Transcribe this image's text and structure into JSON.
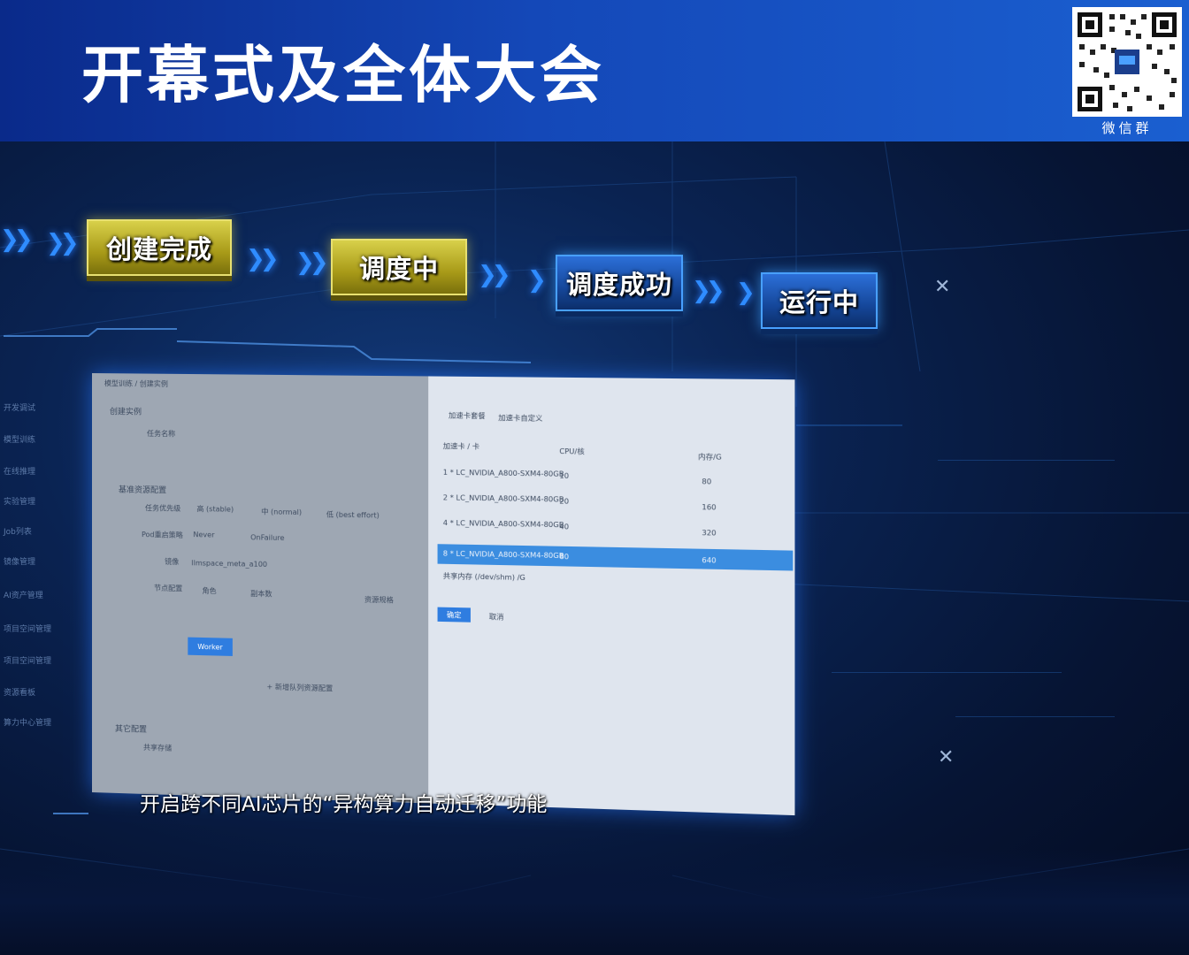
{
  "header": {
    "title": "开幕式及全体大会",
    "qr_caption": "微信群"
  },
  "steps": [
    {
      "label": "创建完成",
      "style": "yellow"
    },
    {
      "label": "调度中",
      "style": "yellow"
    },
    {
      "label": "调度成功",
      "style": "blue"
    },
    {
      "label": "运行中",
      "style": "blue"
    }
  ],
  "screen": {
    "breadcrumb": "模型训练 / 创建实例",
    "section_title": "创建实例",
    "name_label": "任务名称",
    "resource_section": "基准资源配置",
    "priority_label": "任务优先级",
    "priority_options": [
      "高 (stable)",
      "中 (normal)",
      "低 (best effort)"
    ],
    "pod_restart_label": "Pod重启策略",
    "pod_restart_options": [
      "Never",
      "OnFailure"
    ],
    "image_label": "镜像",
    "image_value": "llmspace_meta_a100",
    "node_label": "节点配置",
    "node_columns": [
      "角色",
      "副本数",
      "资源规格"
    ],
    "worker_role": "Worker",
    "add_node": "+ 新增队列资源配置",
    "other_section": "其它配置",
    "shared_storage": "共享存储",
    "right_tabs": [
      "加速卡套餐",
      "加速卡自定义"
    ],
    "table_headers": [
      "加速卡 / 卡",
      "CPU/核",
      "内存/G"
    ],
    "table_rows": [
      {
        "card": "1 * LC_NVIDIA_A800-SXM4-80GB",
        "cpu": "10",
        "mem": "80"
      },
      {
        "card": "2 * LC_NVIDIA_A800-SXM4-80GB",
        "cpu": "20",
        "mem": "160"
      },
      {
        "card": "4 * LC_NVIDIA_A800-SXM4-80GB",
        "cpu": "40",
        "mem": "320"
      },
      {
        "card": "8 * LC_NVIDIA_A800-SXM4-80GB",
        "cpu": "80",
        "mem": "640"
      }
    ],
    "shared_memory": "共享内存 (/dev/shm) /G",
    "confirm": "确定",
    "cancel": "取消",
    "sidebar": [
      "开发调试",
      "模型训练",
      "在线推理",
      "实验管理",
      "Job列表",
      "镜像管理",
      "AI资产管理",
      "项目空间管理",
      "项目空间管理",
      "资源看板",
      "算力中心管理"
    ]
  },
  "subtitle": "开启跨不同AI芯片的“异构算力自动迁移”功能"
}
